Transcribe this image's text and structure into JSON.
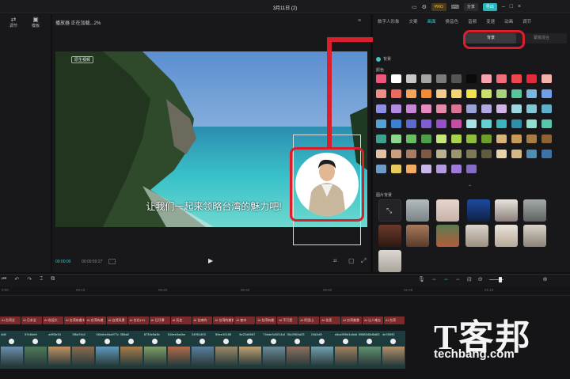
{
  "titlebar": {
    "title": "3月11日 (2)",
    "pro_label": "PRO",
    "share_label": "分享",
    "export_label": "导出"
  },
  "left_panel": {
    "items": [
      {
        "label": "调节"
      },
      {
        "label": "模板"
      }
    ]
  },
  "player": {
    "header": "播放器 正在加载...2%",
    "time_current": "00:00:00",
    "time_total": "00:00:59:27",
    "subtitle": "让我们一起来领略台湾的魅力吧!",
    "tag": "原生视频"
  },
  "right_panel": {
    "tabs": [
      {
        "label": "数字人形象"
      },
      {
        "label": "文案"
      },
      {
        "label": "画面"
      },
      {
        "label": "换音色"
      },
      {
        "label": "音频"
      },
      {
        "label": "变速"
      },
      {
        "label": "动画"
      },
      {
        "label": "调节"
      }
    ],
    "active_tab": "画面",
    "subtabs": [
      {
        "label": "背景"
      },
      {
        "label": "蒙版混合"
      }
    ],
    "active_subtab": "背景",
    "bg_toggle": "背景",
    "color_section": "颜色",
    "image_section": "图片背景",
    "colors": [
      "#f0567a",
      "#ffffff",
      "#c8c8c8",
      "#a5a5a5",
      "#7b7b7b",
      "#555555",
      "#0a0a0a",
      "#f7a3b0",
      "#f36d79",
      "#ef4750",
      "#e22a3a",
      "#f3b2ad",
      "#f08c86",
      "#ec6a5b",
      "#f6a25b",
      "#f48a36",
      "#f6c98d",
      "#f7d672",
      "#f3e34b",
      "#cde06d",
      "#a8d27d",
      "#5ac59d",
      "#77b7e0",
      "#6fa0e6",
      "#8c8fe5",
      "#b38be3",
      "#c886d9",
      "#e58bbf",
      "#e58aa7",
      "#d97693",
      "#9aa2d8",
      "#b1a9e2",
      "#cfb6e6",
      "#a0d6e0",
      "#83c6d6",
      "#5fb0c8",
      "#54a0d9",
      "#3c80d5",
      "#5a6ad1",
      "#7e5ed0",
      "#9450c6",
      "#c74ca4",
      "#a7e3e4",
      "#64d1d0",
      "#3bb5bd",
      "#2f8fa7",
      "#8de0cc",
      "#57c7ac",
      "#3da28d",
      "#8ed58d",
      "#68bf63",
      "#4e9f4a",
      "#c6e57d",
      "#a9d24f",
      "#8ebf3a",
      "#6f9d2b",
      "#d8b37c",
      "#c69a5b",
      "#a77d45",
      "#8b6335",
      "#e3c1a1",
      "#c99f7f",
      "#a87d61",
      "#7d5a44",
      "#b9b28e",
      "#9c9571",
      "#7f7856",
      "#5f5a40",
      "#e8d4aa",
      "#d3b986",
      "#4d8fb3",
      "#3f72a6",
      "#6e9cc6",
      "#e7c95f",
      "#f0aa62",
      "#c7b8e7",
      "#b49adf",
      "#9f7ad8",
      "#866bc6"
    ],
    "image_labels": [
      "无"
    ]
  },
  "timeline": {
    "ticks": [
      "0:00",
      "00:10",
      "00:20",
      "00:30",
      "00:40",
      "00:50",
      "01:00",
      "01:10"
    ],
    "subtitle_clips": [
      "AI 台湾全",
      "AI 日本全",
      "AI 欢迎大",
      "AI 台湾有着丰富的",
      "AI 台湾有着",
      "AI 自然风景",
      "AI 台北101",
      "AI 日月潭",
      "AI 历史",
      "AI 台南的",
      "AI 台湾的美食",
      "AI 夜市",
      "AI 台湾有着",
      "AI 不只是",
      "AI 阿里山",
      "AI 花莲",
      "AI 台湾美食",
      "AI 让人难忘",
      "AI 台湾"
    ],
    "video_heads": [
      "4d6",
      "57e84e6",
      "a993e34",
      "3f6a74c2",
      "064dbe0da977c",
      "355a8",
      "8733e5a3b",
      "516ee3a4be",
      "24951403",
      "59ee10185",
      "9e22a5567",
      "74bde3c5214a5",
      "36c2984a33",
      "24d2cf0",
      "e8cd395d1c8dd",
      "5988345d5d63",
      "4e78092"
    ]
  },
  "watermark": {
    "line1": "T客邦",
    "line2": "techbang.com"
  }
}
